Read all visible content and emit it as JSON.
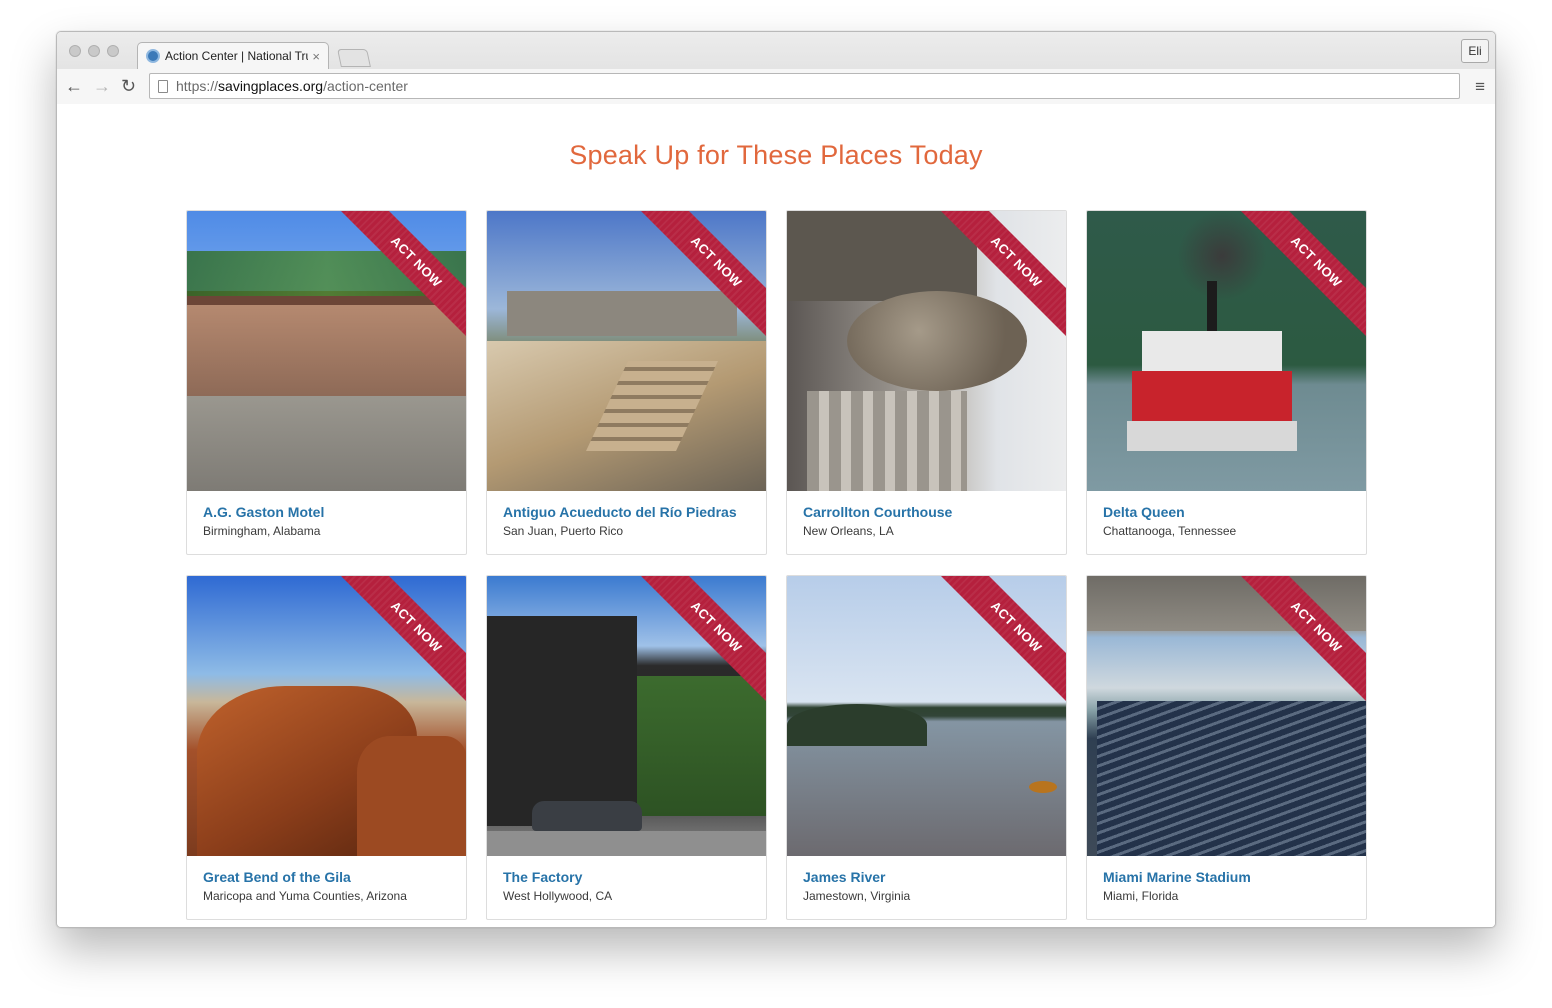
{
  "browser": {
    "tab_title": "Action Center | National Trust",
    "tab_close": "×",
    "profile": "Eli",
    "nav": {
      "back": "←",
      "forward": "→",
      "reload": "↻",
      "menu": "≡"
    },
    "url": {
      "scheme": "https://",
      "host": "savingplaces.org",
      "path": "/action-center"
    }
  },
  "page": {
    "heading": "Speak Up for These Places Today",
    "ribbon_label": "ACT NOW",
    "places": [
      {
        "title": "A.G. Gaston Motel",
        "location": "Birmingham, Alabama"
      },
      {
        "title": "Antiguo Acueducto del Río Piedras",
        "location": "San Juan, Puerto Rico"
      },
      {
        "title": "Carrollton Courthouse",
        "location": "New Orleans, LA"
      },
      {
        "title": "Delta Queen",
        "location": "Chattanooga, Tennessee"
      },
      {
        "title": "Great Bend of the Gila",
        "location": "Maricopa and Yuma Counties, Arizona"
      },
      {
        "title": "The Factory",
        "location": "West Hollywood, CA"
      },
      {
        "title": "James River",
        "location": "Jamestown, Virginia"
      },
      {
        "title": "Miami Marine Stadium",
        "location": "Miami, Florida"
      }
    ]
  },
  "colors": {
    "heading": "#e1683d",
    "title_link": "#2773a8",
    "ribbon": "#b5203d"
  }
}
